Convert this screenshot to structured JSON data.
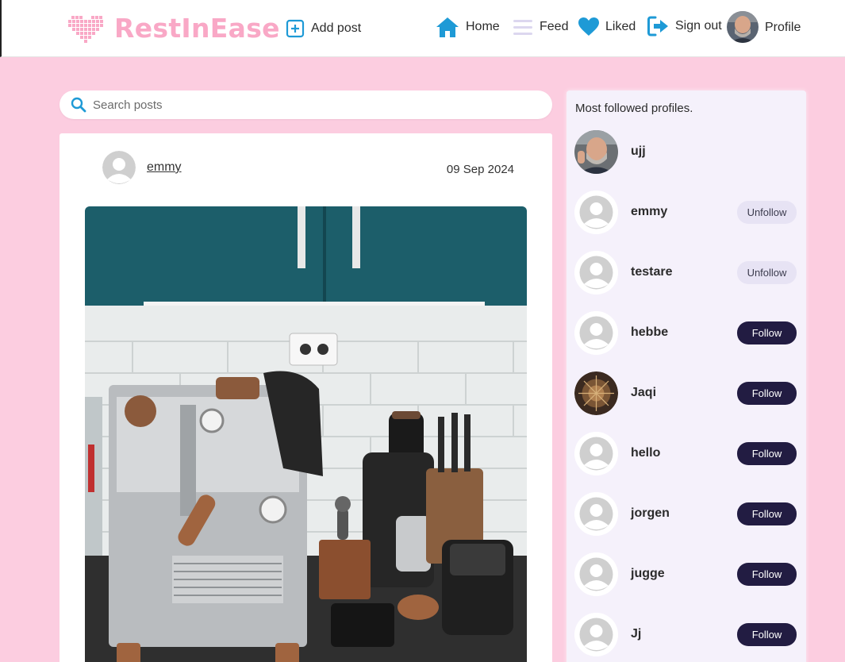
{
  "nav": {
    "brand": "RestInEase",
    "add_post": "Add post",
    "home": "Home",
    "feed": "Feed",
    "liked": "Liked",
    "sign_out": "Sign out",
    "profile": "Profile"
  },
  "search": {
    "placeholder": "Search posts"
  },
  "post": {
    "author": "emmy",
    "date": "09 Sep 2024"
  },
  "sidebar": {
    "title": "Most followed profiles.",
    "profiles": [
      {
        "name": "ujj",
        "button": ""
      },
      {
        "name": "emmy",
        "button": "Unfollow"
      },
      {
        "name": "testare",
        "button": "Unfollow"
      },
      {
        "name": "hebbe",
        "button": "Follow"
      },
      {
        "name": "Jaqi",
        "button": "Follow"
      },
      {
        "name": "hello",
        "button": "Follow"
      },
      {
        "name": "jorgen",
        "button": "Follow"
      },
      {
        "name": "jugge",
        "button": "Follow"
      },
      {
        "name": "Jj",
        "button": "Follow"
      }
    ]
  },
  "colors": {
    "brand_pink": "#f9a8c6",
    "background": "#fccde0",
    "accent_blue": "#1e9ad6",
    "follow_dark": "#221c42"
  }
}
